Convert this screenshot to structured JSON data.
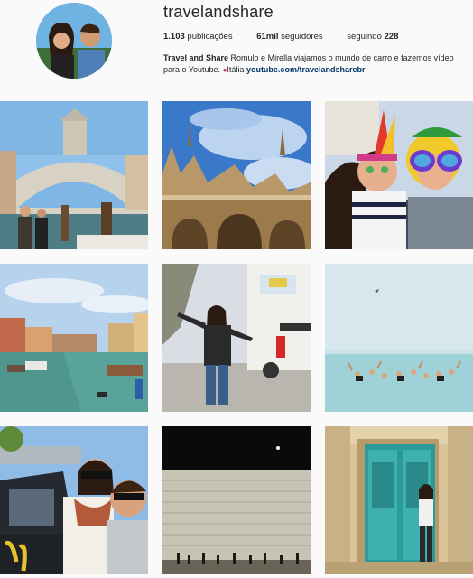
{
  "profile": {
    "username": "travelandshare",
    "posts_count": "1.103",
    "posts_label": "publicações",
    "followers_count": "61mil",
    "followers_label": "seguidores",
    "following_label": "seguindo",
    "following_count": "228",
    "bio_name": "Travel and Share",
    "bio_text": " Romulo e Mirella viajamos o mundo de carro e fazemos vídeo para o Youtube. ",
    "bio_location": "Itália",
    "bio_link": "youtube.com/travelandsharebr"
  },
  "colors": {
    "link": "#003569",
    "pin": "#e0245e",
    "background": "#fafafa"
  },
  "grid": {
    "posts": [
      {
        "subject": "rialto-bridge-venice-couple"
      },
      {
        "subject": "basilica-san-marco-facade"
      },
      {
        "subject": "carnival-selfie-glasses"
      },
      {
        "subject": "grand-canal-venice"
      },
      {
        "subject": "woman-dancing-by-camper"
      },
      {
        "subject": "swimmers-dead-sea"
      },
      {
        "subject": "couple-selfie-travel-car"
      },
      {
        "subject": "western-wall-night"
      },
      {
        "subject": "woman-teal-door"
      }
    ]
  }
}
